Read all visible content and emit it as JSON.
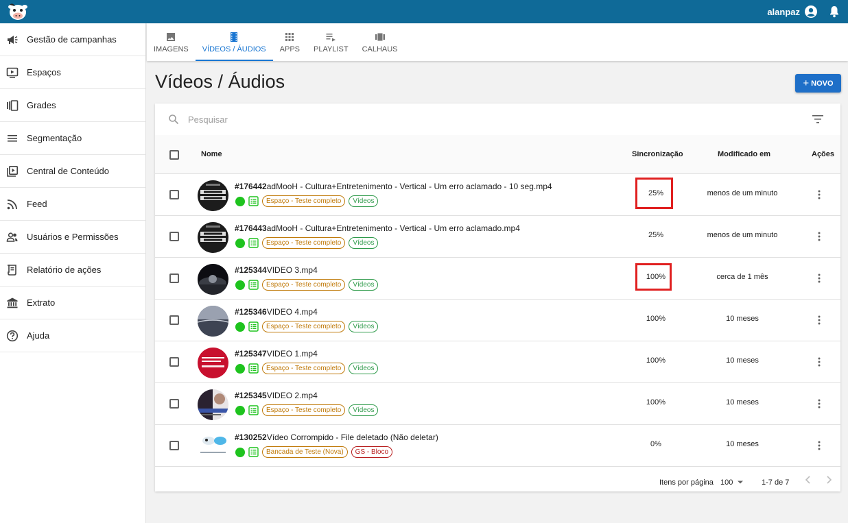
{
  "topbar": {
    "username": "alanpaz"
  },
  "sidebar": {
    "items": [
      {
        "label": "Gestão de campanhas",
        "icon": "megaphone-icon"
      },
      {
        "label": "Espaços",
        "icon": "tv-play-icon"
      },
      {
        "label": "Grades",
        "icon": "carousel-icon"
      },
      {
        "label": "Segmentação",
        "icon": "lines-icon"
      },
      {
        "label": "Central de Conteúdo",
        "icon": "video-library-icon"
      },
      {
        "label": "Feed",
        "icon": "rss-icon"
      },
      {
        "label": "Usuários e Permissões",
        "icon": "people-icon"
      },
      {
        "label": "Relatório de ações",
        "icon": "receipt-icon"
      },
      {
        "label": "Extrato",
        "icon": "bank-icon"
      },
      {
        "label": "Ajuda",
        "icon": "help-icon"
      }
    ]
  },
  "tabs": [
    {
      "label": "IMAGENS",
      "icon": "image-icon",
      "active": false
    },
    {
      "label": "VÍDEOS / ÁUDIOS",
      "icon": "film-icon",
      "active": true
    },
    {
      "label": "APPS",
      "icon": "apps-grid-icon",
      "active": false
    },
    {
      "label": "PLAYLIST",
      "icon": "playlist-icon",
      "active": false
    },
    {
      "label": "CALHAUS",
      "icon": "carousel-icon",
      "active": false
    }
  ],
  "page": {
    "title": "Vídeos / Áudios",
    "new_button": "NOVO"
  },
  "search": {
    "placeholder": "Pesquisar"
  },
  "table": {
    "headers": {
      "name": "Nome",
      "sync": "Sincronização",
      "modified": "Modificado em",
      "actions": "Ações"
    },
    "rows": [
      {
        "id": "#176442",
        "name": "adMooH - Cultura+Entretenimento - Vertical - Um erro aclamado - 10 seg.mp4",
        "tags": [
          {
            "text": "Espaço - Teste completo",
            "color": "orange"
          },
          {
            "text": "Vídeos",
            "color": "green"
          }
        ],
        "sync": "25%",
        "modified": "menos de um minuto",
        "highlighted": true
      },
      {
        "id": "#176443",
        "name": "adMooH - Cultura+Entretenimento - Vertical - Um erro aclamado.mp4",
        "tags": [
          {
            "text": "Espaço - Teste completo",
            "color": "orange"
          },
          {
            "text": "Vídeos",
            "color": "green"
          }
        ],
        "sync": "25%",
        "modified": "menos de um minuto",
        "highlighted": false
      },
      {
        "id": "#125344",
        "name": "VIDEO 3.mp4",
        "tags": [
          {
            "text": "Espaço - Teste completo",
            "color": "orange"
          },
          {
            "text": "Vídeos",
            "color": "green"
          }
        ],
        "sync": "100%",
        "modified": "cerca de 1 mês",
        "highlighted": true
      },
      {
        "id": "#125346",
        "name": "VIDEO 4.mp4",
        "tags": [
          {
            "text": "Espaço - Teste completo",
            "color": "orange"
          },
          {
            "text": "Vídeos",
            "color": "green"
          }
        ],
        "sync": "100%",
        "modified": "10 meses",
        "highlighted": false
      },
      {
        "id": "#125347",
        "name": "VIDEO 1.mp4",
        "tags": [
          {
            "text": "Espaço - Teste completo",
            "color": "orange"
          },
          {
            "text": "Vídeos",
            "color": "green"
          }
        ],
        "sync": "100%",
        "modified": "10 meses",
        "highlighted": false
      },
      {
        "id": "#125345",
        "name": "VIDEO 2.mp4",
        "tags": [
          {
            "text": "Espaço - Teste completo",
            "color": "orange"
          },
          {
            "text": "Vídeos",
            "color": "green"
          }
        ],
        "sync": "100%",
        "modified": "10 meses",
        "highlighted": false
      },
      {
        "id": "#130252",
        "name": "Vídeo Corrompido - File deletado (Não deletar)",
        "tags": [
          {
            "text": "Bancada de Teste (Nova)",
            "color": "orange"
          },
          {
            "text": "GS - Bloco",
            "color": "red"
          }
        ],
        "sync": "0%",
        "modified": "10 meses",
        "highlighted": false
      }
    ]
  },
  "footer": {
    "per_page_label": "Itens por página",
    "per_page_value": "100",
    "range": "1-7 de 7"
  },
  "colors": {
    "topbar": "#0f6a98",
    "primary": "#1976d2",
    "highlight": "#e02020",
    "status_dot": "#1ec31e"
  }
}
